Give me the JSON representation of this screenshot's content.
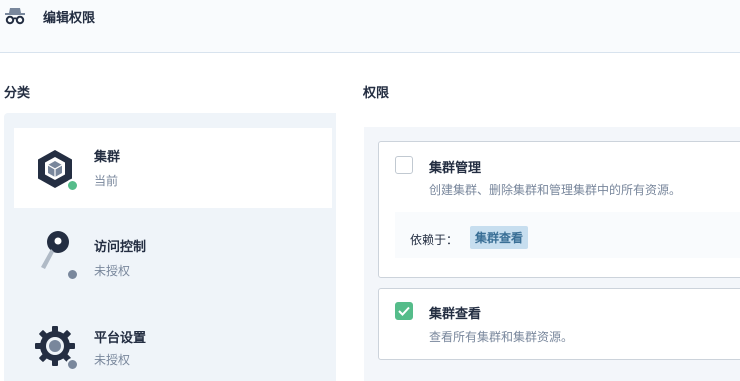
{
  "header": {
    "title": "编辑权限",
    "icon": "incognito-icon"
  },
  "categories_label": "分类",
  "permissions_label": "权限",
  "categories": [
    {
      "name": "集群",
      "status": "当前",
      "icon": "cluster-cube-icon",
      "dot_color": "#55bc8a",
      "active": true
    },
    {
      "name": "访问控制",
      "status": "未授权",
      "icon": "key-icon",
      "dot_color": "#79879c",
      "active": false
    },
    {
      "name": "平台设置",
      "status": "未授权",
      "icon": "gear-icon",
      "dot_color": "#79879c",
      "active": false
    }
  ],
  "permissions": [
    {
      "title": "集群管理",
      "description": "创建集群、删除集群和管理集群中的所有资源。",
      "checked": false,
      "depends_label": "依赖于：",
      "depends_tag": "集群查看"
    },
    {
      "title": "集群查看",
      "description": "查看所有集群和集群资源。",
      "checked": true
    }
  ],
  "colors": {
    "accent_green": "#55bc8a",
    "muted": "#79879c",
    "tag_bg": "#c7deef"
  }
}
